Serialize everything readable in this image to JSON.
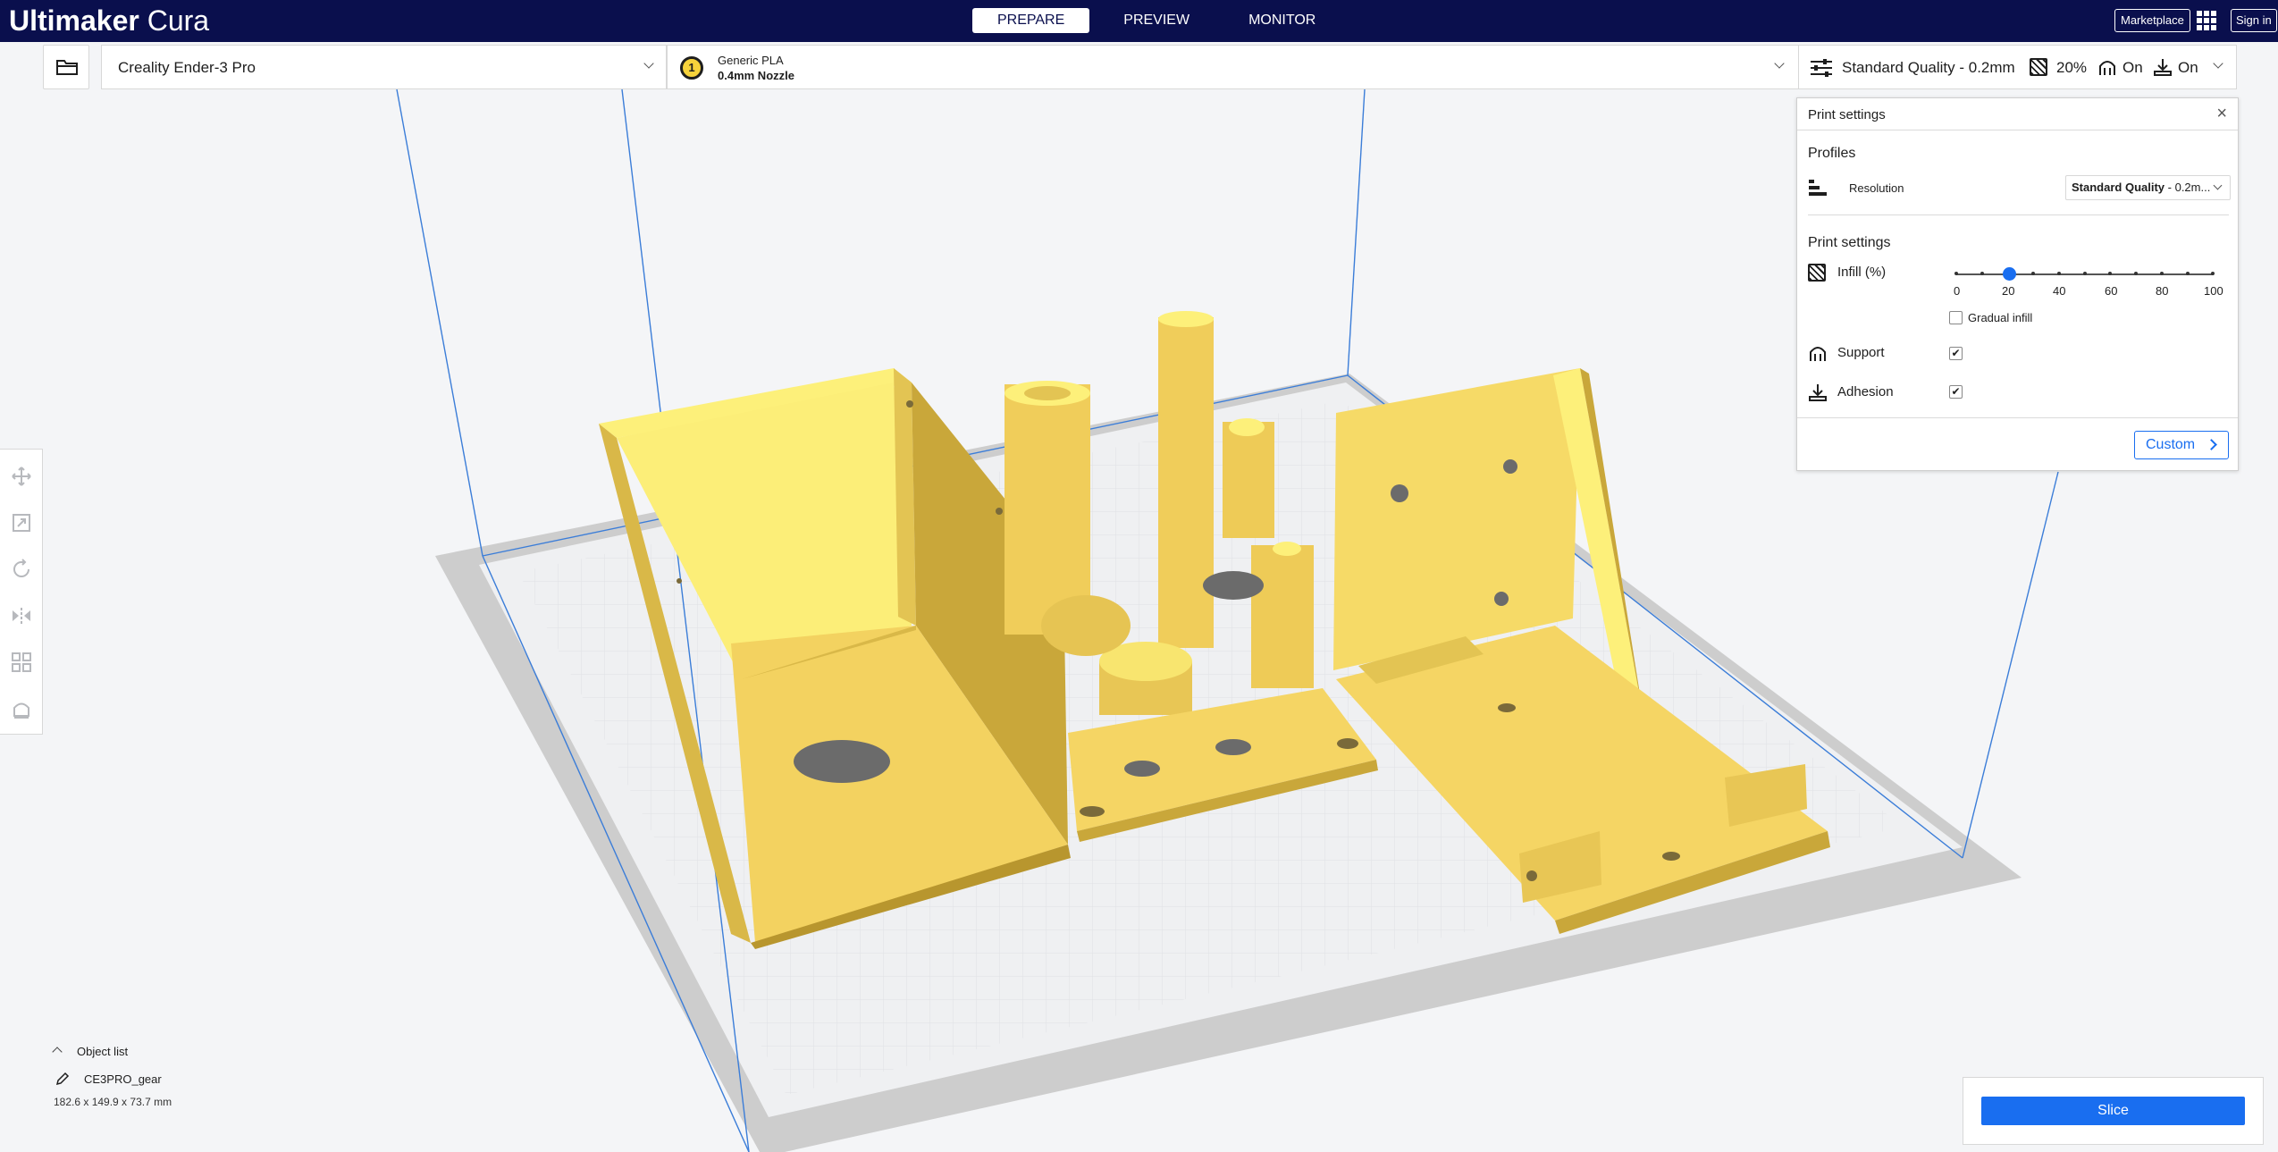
{
  "app": {
    "brand_bold": "Ultimaker",
    "brand_light": " Cura"
  },
  "header": {
    "tabs": [
      {
        "label": "PREPARE",
        "active": true
      },
      {
        "label": "PREVIEW",
        "active": false
      },
      {
        "label": "MONITOR",
        "active": false
      }
    ],
    "marketplace_label": "Marketplace",
    "signin_label": "Sign in"
  },
  "toolbar": {
    "printer": "Creality Ender-3 Pro",
    "extruder_number": "1",
    "material": "Generic PLA",
    "nozzle": "0.4mm Nozzle",
    "quality_summary": "Standard Quality - 0.2mm",
    "infill_summary": "20%",
    "support_summary": "On",
    "adhesion_summary": "On"
  },
  "print_settings": {
    "title": "Print settings",
    "close_glyph": "×",
    "profiles_heading": "Profiles",
    "resolution_label": "Resolution",
    "resolution_value_bold": "Standard Quality",
    "resolution_value_rest": " - 0.2m...",
    "settings_heading": "Print settings",
    "infill_label": "Infill (%)",
    "infill_value": 20,
    "infill_ticks": [
      "0",
      "20",
      "40",
      "60",
      "80",
      "100"
    ],
    "gradual_infill_label": "Gradual infill",
    "gradual_infill_checked": false,
    "support_label": "Support",
    "support_checked": true,
    "adhesion_label": "Adhesion",
    "adhesion_checked": true,
    "custom_label": "Custom"
  },
  "object_list": {
    "toggle_label": "Object list",
    "object_name": "CE3PRO_gear",
    "dimensions": "182.6 x 149.9 x 73.7 mm"
  },
  "slice": {
    "label": "Slice"
  },
  "colors": {
    "header_bg": "#0a0f4d",
    "accent": "#196ef0",
    "model_fill": "#f5d564",
    "model_light": "#fdf07a",
    "model_dark": "#c9a73a",
    "build_plate": "#f7f8f9"
  },
  "icons": {
    "open": "folder-icon",
    "quality": "sliders-icon",
    "infill": "infill-icon",
    "support": "support-icon",
    "adhesion": "adhesion-icon",
    "tools": [
      "move-icon",
      "scale-icon",
      "rotate-icon",
      "mirror-icon",
      "per-model-settings-icon",
      "support-blocker-icon"
    ],
    "views": [
      "view-3d-icon",
      "view-front-icon",
      "view-top-icon",
      "view-left-icon",
      "view-right-icon"
    ]
  }
}
